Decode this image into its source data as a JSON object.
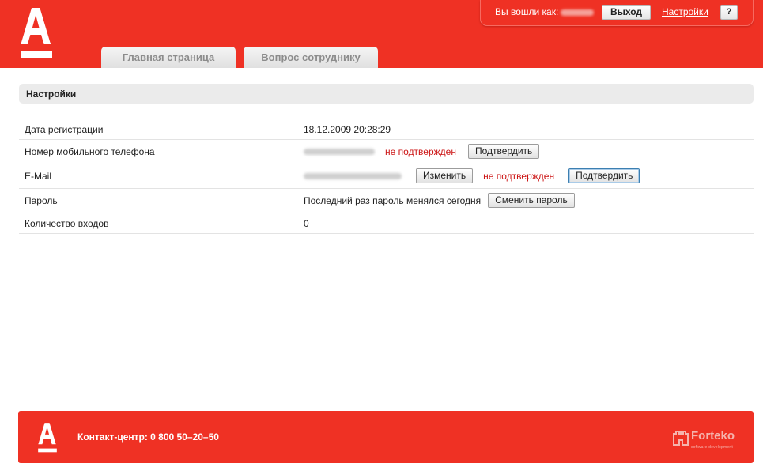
{
  "header": {
    "logo_letter": "A",
    "logged_in_label": "Вы вошли как:",
    "logout_button": "Выход",
    "settings_link": "Настройки",
    "help_button": "?",
    "tabs": [
      {
        "label": "Главная страница"
      },
      {
        "label": "Вопрос сотруднику"
      }
    ]
  },
  "section": {
    "title": "Настройки"
  },
  "settings": {
    "rows": [
      {
        "label": "Дата регистрации",
        "value": "18.12.2009 20:28:29"
      },
      {
        "label": "Номер мобильного телефона",
        "status": "не подтвержден",
        "confirm_button": "Подтвердить"
      },
      {
        "label": "E-Mail",
        "change_button": "Изменить",
        "status": "не подтвержден",
        "confirm_button": "Подтвердить"
      },
      {
        "label": "Пароль",
        "value": "Последний раз пароль менялся сегодня",
        "change_password_button": "Сменить пароль"
      },
      {
        "label": "Количество входов",
        "value": "0"
      }
    ]
  },
  "footer": {
    "contact": "Контакт-центр: 0 800 50–20–50",
    "brand": "Forteko",
    "brand_sub": "software development"
  },
  "colors": {
    "brand_red": "#ef3124",
    "status_red": "#cc1515",
    "section_gray": "#ebebeb"
  }
}
